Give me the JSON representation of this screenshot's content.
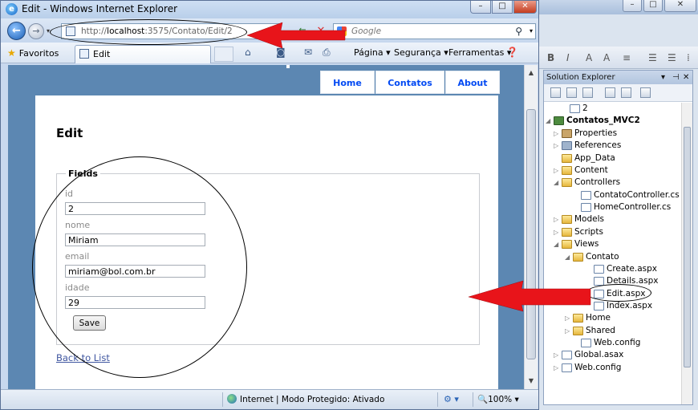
{
  "browser": {
    "window_title": "Edit - Windows Internet Explorer",
    "address_url_prefix": "http://",
    "address_url_host": "localhost",
    "address_url_path": ":3575/Contato/Edit/2",
    "search_placeholder": "Google",
    "favorites_label": "Favoritos",
    "tab_label": "Edit",
    "menu_pagina": "Página",
    "menu_seguranca": "Segurança",
    "menu_ferramentas": "Ferramentas",
    "status_zone": "Internet | Modo Protegido: Ativado",
    "zoom": "100%"
  },
  "site": {
    "menu": [
      {
        "label": "Home"
      },
      {
        "label": "Contatos"
      },
      {
        "label": "About"
      }
    ],
    "page_title": "Edit",
    "fieldset_legend": "Fields",
    "fields": [
      {
        "label": "id",
        "value": "2"
      },
      {
        "label": "nome",
        "value": "Miriam"
      },
      {
        "label": "email",
        "value": "miriam@bol.com.br"
      },
      {
        "label": "idade",
        "value": "29"
      }
    ],
    "save_label": "Save",
    "back_link": "Back to List"
  },
  "solution_explorer": {
    "title": "Solution Explorer",
    "items": [
      {
        "label": "2",
        "icon": "file-icon"
      },
      {
        "label": "Contatos_MVC2",
        "icon": "project-icon"
      },
      {
        "label": "Properties",
        "icon": "properties-icon"
      },
      {
        "label": "References",
        "icon": "references-icon"
      },
      {
        "label": "App_Data",
        "icon": "folder-icon"
      },
      {
        "label": "Content",
        "icon": "folder-icon"
      },
      {
        "label": "Controllers",
        "icon": "folder-icon"
      },
      {
        "label": "ContatoController.cs",
        "icon": "file-icon"
      },
      {
        "label": "HomeController.cs",
        "icon": "file-icon"
      },
      {
        "label": "Models",
        "icon": "folder-icon"
      },
      {
        "label": "Scripts",
        "icon": "folder-icon"
      },
      {
        "label": "Views",
        "icon": "folder-icon"
      },
      {
        "label": "Contato",
        "icon": "folder-icon"
      },
      {
        "label": "Create.aspx",
        "icon": "file-icon"
      },
      {
        "label": "Details.aspx",
        "icon": "file-icon"
      },
      {
        "label": "Edit.aspx",
        "icon": "file-icon"
      },
      {
        "label": "Index.aspx",
        "icon": "file-icon"
      },
      {
        "label": "Home",
        "icon": "folder-icon"
      },
      {
        "label": "Shared",
        "icon": "folder-icon"
      },
      {
        "label": "Web.config",
        "icon": "file-icon"
      },
      {
        "label": "Global.asax",
        "icon": "file-icon"
      },
      {
        "label": "Web.config",
        "icon": "file-icon"
      }
    ]
  },
  "colors": {
    "site_background": "#5c87b2",
    "menu_link": "#034af3",
    "annotation_arrow": "#e8141a"
  }
}
